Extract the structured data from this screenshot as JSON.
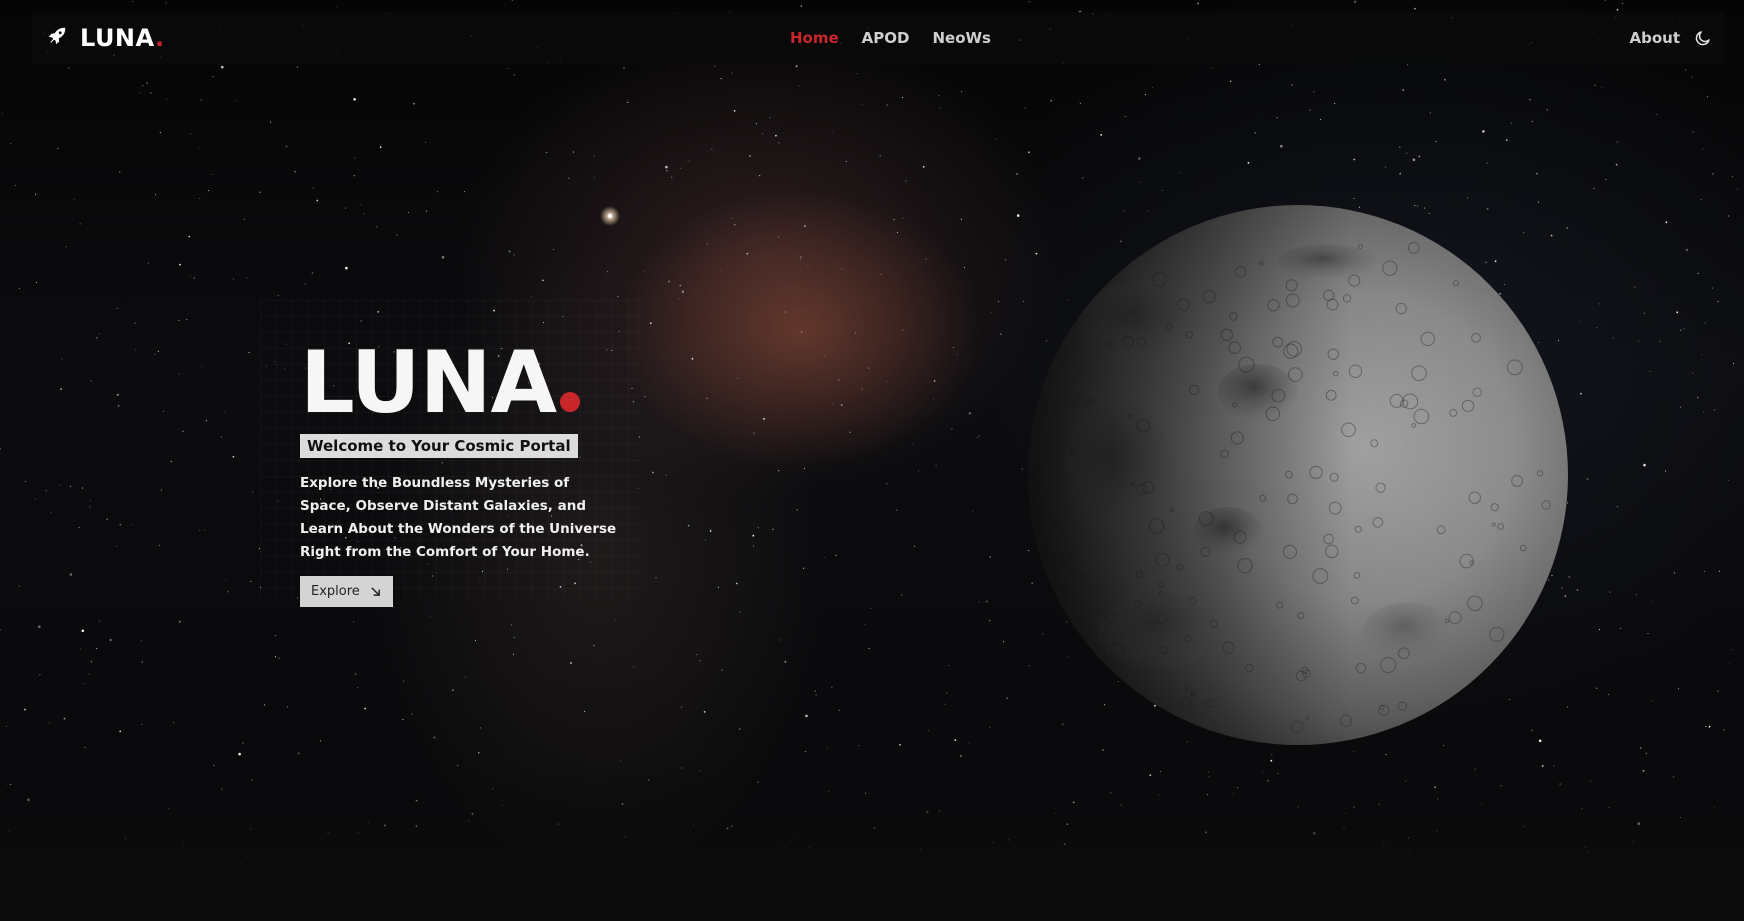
{
  "navbar": {
    "brand_name": "LUNA",
    "brand_dot": ".",
    "links": [
      {
        "label": "Home",
        "active": true
      },
      {
        "label": "APOD",
        "active": false
      },
      {
        "label": "NeoWs",
        "active": false
      }
    ],
    "about_label": "About",
    "icons": {
      "brand": "rocket-icon",
      "theme_toggle": "moon-icon"
    }
  },
  "hero": {
    "title": "LUNA",
    "tagline": "Welcome to Your Cosmic Portal",
    "description": "Explore the Boundless Mysteries of Space, Observe Distant Galaxies, and Learn About the Wonders of the Universe Right from the Comfort of Your Home.",
    "explore_label": "Explore",
    "explore_icon": "arrow-down-right-icon"
  },
  "colors": {
    "accent": "#c8262b",
    "background": "#0b0b0b",
    "text": "#ffffff",
    "tagline_bg": "#dcdcdc",
    "button_bg": "#d4d4d4"
  }
}
